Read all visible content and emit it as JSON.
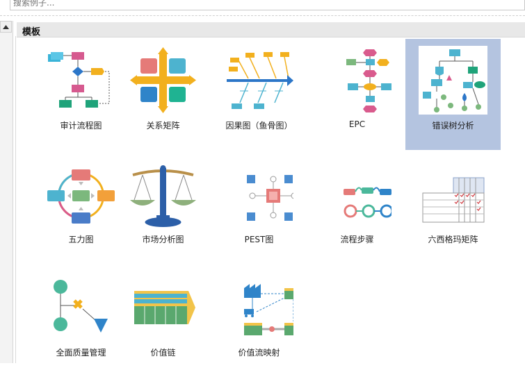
{
  "search": {
    "placeholder": "搜索例子..."
  },
  "section": {
    "title": "模板"
  },
  "templates": [
    {
      "label": "审计流程图",
      "icon": "audit-flowchart-icon"
    },
    {
      "label": "关系矩阵",
      "icon": "relation-matrix-icon"
    },
    {
      "label": "因果图（鱼骨图）",
      "icon": "fishbone-diagram-icon"
    },
    {
      "label": "EPC",
      "icon": "epc-diagram-icon"
    },
    {
      "label": "错误树分析",
      "icon": "fault-tree-icon",
      "selected": true
    },
    {
      "label": "五力图",
      "icon": "five-forces-icon"
    },
    {
      "label": "市场分析图",
      "icon": "market-scale-icon"
    },
    {
      "label": "PEST图",
      "icon": "pest-diagram-icon"
    },
    {
      "label": "流程步骤",
      "icon": "process-steps-icon"
    },
    {
      "label": "六西格玛矩阵",
      "icon": "six-sigma-matrix-icon"
    },
    {
      "label": "全面质量管理",
      "icon": "tqm-diagram-icon"
    },
    {
      "label": "价值链",
      "icon": "value-chain-icon"
    },
    {
      "label": "价值流映射",
      "icon": "value-stream-map-icon"
    }
  ],
  "colors": {
    "selected_bg": "#b4c4e0",
    "header_bg": "#e8e8e8"
  }
}
